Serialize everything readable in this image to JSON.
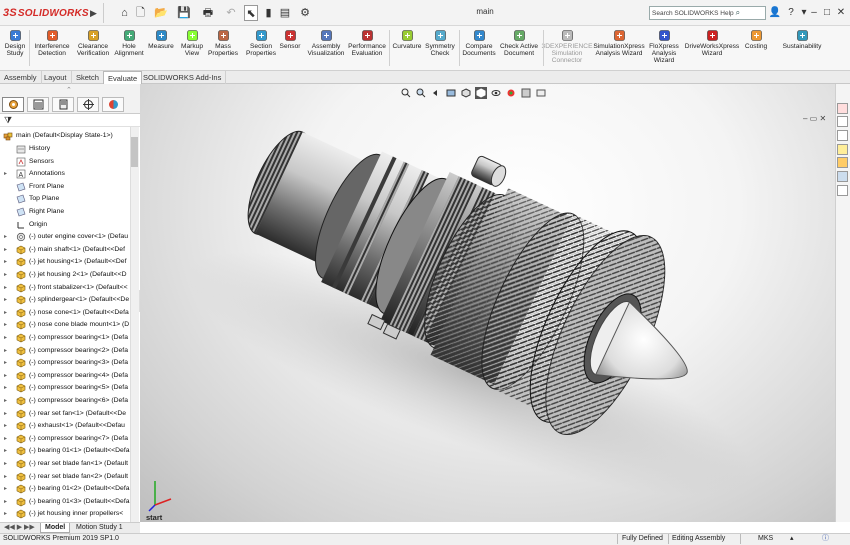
{
  "app": {
    "logo": "SOLIDWORKS",
    "logo_ds": "3S",
    "document_title": "main"
  },
  "search": {
    "placeholder": "Search SOLIDWORKS Help"
  },
  "ribbon": {
    "items": [
      {
        "label": "Design\nStudy",
        "icon": "design-study-icon"
      },
      {
        "label": "Interference\nDetection",
        "icon": "interference-detection-icon"
      },
      {
        "label": "Clearance\nVerification",
        "icon": "clearance-verification-icon"
      },
      {
        "label": "Hole\nAlignment",
        "icon": "hole-alignment-icon"
      },
      {
        "label": "Measure",
        "icon": "measure-icon"
      },
      {
        "label": "Markup\nView",
        "icon": "markup-icon"
      },
      {
        "label": "Mass\nProperties",
        "icon": "mass-properties-icon"
      },
      {
        "label": "Section\nProperties",
        "icon": "section-properties-icon"
      },
      {
        "label": "Sensor",
        "icon": "sensor-icon"
      },
      {
        "label": "Assembly\nVisualization",
        "icon": "assembly-visualization-icon"
      },
      {
        "label": "Performance\nEvaluation",
        "icon": "performance-evaluation-icon"
      },
      {
        "label": "Curvature",
        "icon": "curvature-icon"
      },
      {
        "label": "Symmetry\nCheck",
        "icon": "symmetry-check-icon"
      },
      {
        "label": "Compare\nDocuments",
        "icon": "compare-documents-icon"
      },
      {
        "label": "Check Active\nDocument",
        "icon": "check-active-document-icon"
      },
      {
        "label": "3DEXPERIENCE\nSimulation\nConnector",
        "icon": "3dexperience-icon"
      },
      {
        "label": "SimulationXpress\nAnalysis Wizard",
        "icon": "simulationxpress-icon"
      },
      {
        "label": "FloXpress\nAnalysis\nWizard",
        "icon": "floxpress-icon"
      },
      {
        "label": "DriveWorksXpress\nWizard",
        "icon": "driveworksxpress-icon"
      },
      {
        "label": "Costing",
        "icon": "costing-icon"
      },
      {
        "label": "Sustainability",
        "icon": "sustainability-icon"
      }
    ]
  },
  "tabs": [
    "Assembly",
    "Layout",
    "Sketch",
    "Evaluate",
    "SOLIDWORKS Add-Ins"
  ],
  "active_tab": "Evaluate",
  "tree": {
    "root": "main  (Default<Display State-1>)",
    "items": [
      "History",
      "Sensors",
      "Annotations",
      "Front Plane",
      "Top Plane",
      "Right Plane",
      "Origin",
      "(-) outer engine cover<1> (Defau",
      "(-) main shaft<1> (Default<<Def",
      "(-) jet housing<1> (Default<<Def",
      "(-) jet housing 2<1> (Default<<D",
      "(-) front stabalizer<1> (Default<<",
      "(-) splindergear<1> (Default<<De",
      "(-) nose cone<1> (Default<<Defa",
      "(-) nose cone blade mount<1> (D",
      "(-) compressor bearing<1> (Defa",
      "(-) compressor bearing<2> (Defa",
      "(-) compressor bearing<3> (Defa",
      "(-) compressor bearing<4> (Defa",
      "(-) compressor bearing<5> (Defa",
      "(-) compressor bearing<6> (Defa",
      "(-) rear set fan<1> (Default<<De",
      "(-) exhaust<1> (Default<<Defau",
      "(-) compressor bearing<7> (Defa",
      "(-) bearing 01<1> (Default<<Defa",
      "(-) rear set blade fan<1> (Default",
      "(-) rear set blade fan<2> (Default",
      "(-) bearing 01<2> (Default<<Defa",
      "(-) bearing 01<3> (Default<<Defa",
      "(-) jet housing inner propellers<"
    ]
  },
  "bottom_tabs": [
    "Model",
    "Motion Study 1"
  ],
  "viewport": {
    "triad_label": "start"
  },
  "status": {
    "version": "SOLIDWORKS Premium 2019 SP1.0",
    "state": "Fully Defined",
    "mode": "Editing Assembly",
    "units": "MKS"
  }
}
